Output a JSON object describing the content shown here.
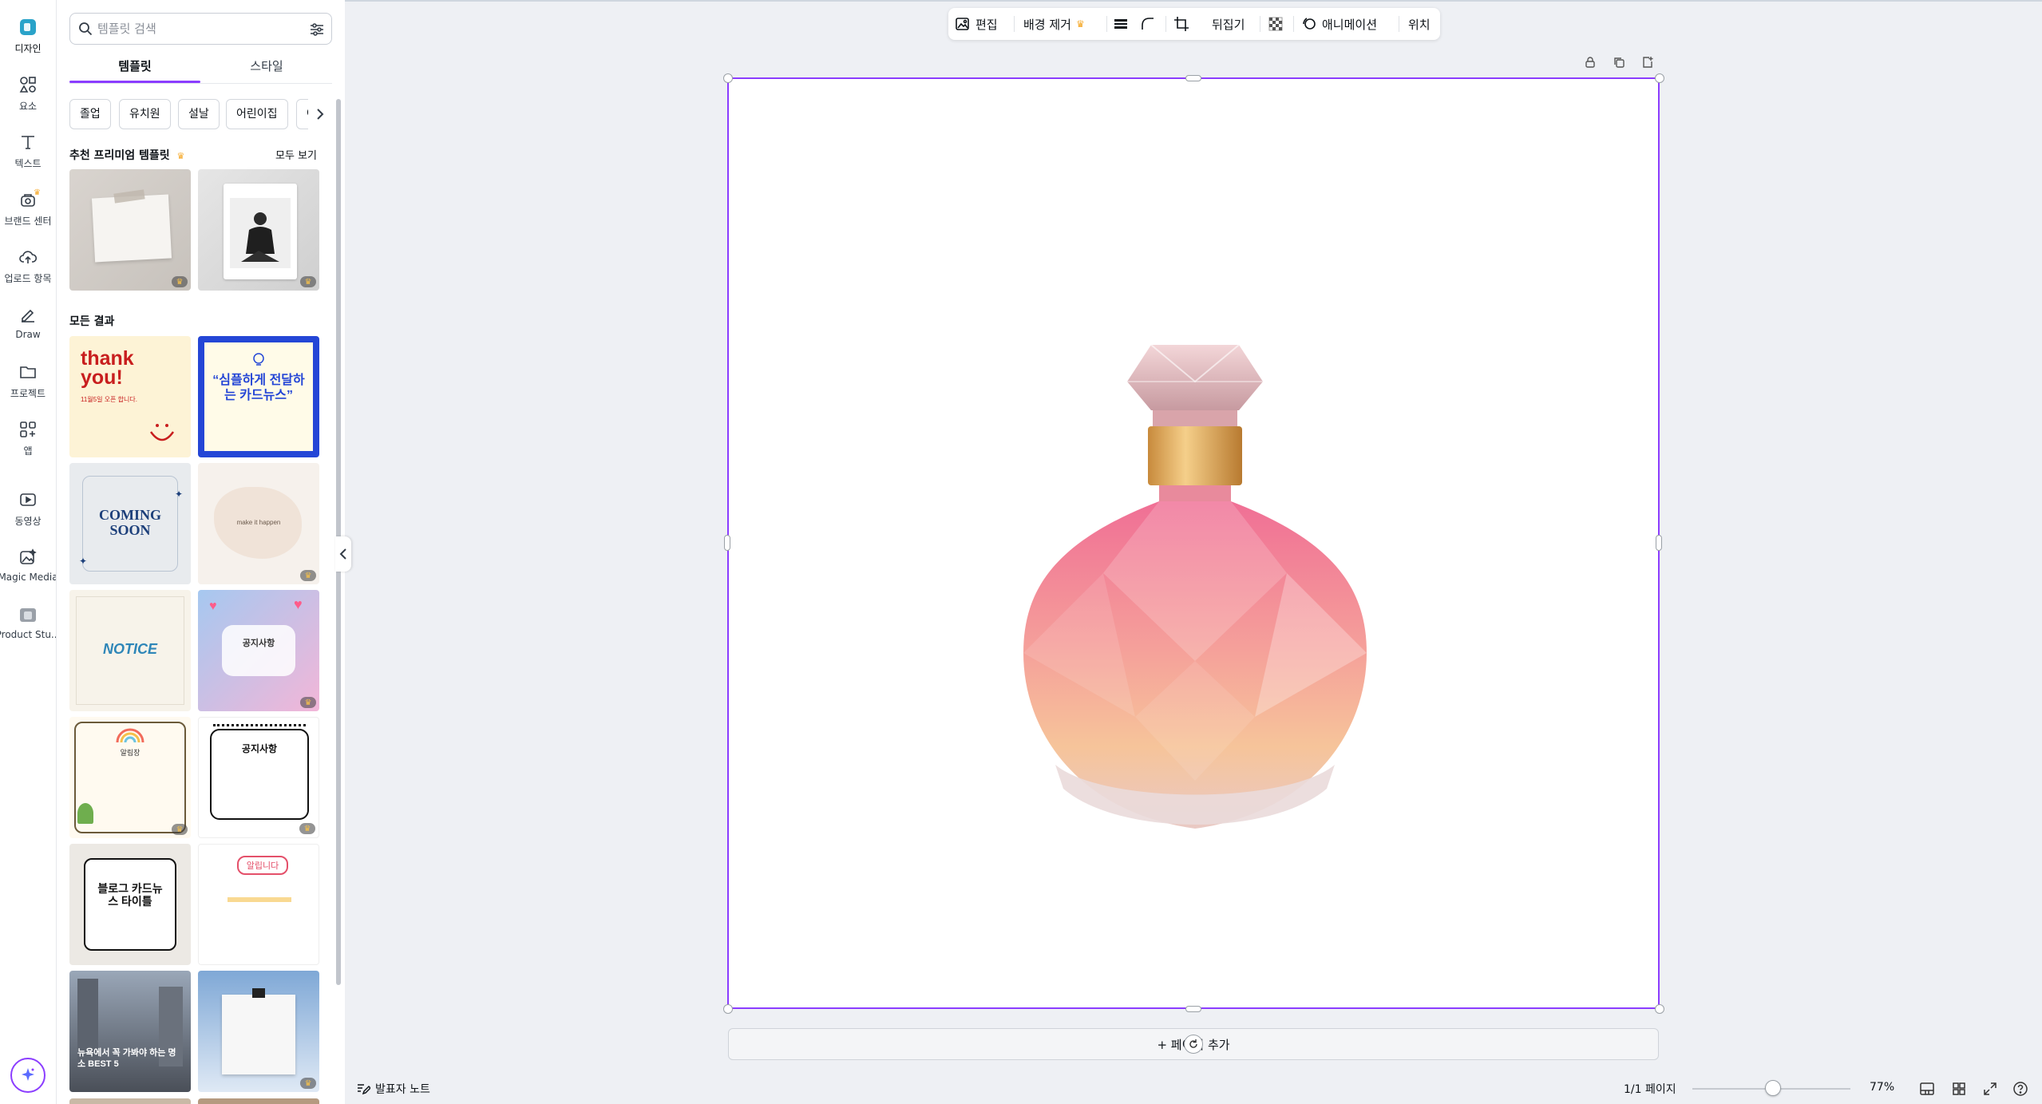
{
  "rail": {
    "items": [
      {
        "label": "디자인",
        "icon": "design-icon"
      },
      {
        "label": "요소",
        "icon": "elements-icon"
      },
      {
        "label": "텍스트",
        "icon": "text-icon"
      },
      {
        "label": "브랜드 센터",
        "icon": "brand-icon"
      },
      {
        "label": "업로드 항목",
        "icon": "upload-cloud-icon"
      },
      {
        "label": "Draw",
        "icon": "draw-pen-icon"
      },
      {
        "label": "프로젝트",
        "icon": "folder-icon"
      },
      {
        "label": "앱",
        "icon": "apps-icon"
      },
      {
        "label": "동영상",
        "icon": "video-icon"
      },
      {
        "label": "Magic Media",
        "icon": "magic-media-icon"
      },
      {
        "label": "Product Stu...",
        "icon": "product-studio-icon"
      }
    ]
  },
  "panel": {
    "search_placeholder": "템플릿 검색",
    "tabs": [
      "템플릿",
      "스타일"
    ],
    "chips": [
      "졸업",
      "유치원",
      "설날",
      "어린이집",
      "여"
    ],
    "premium_heading": "추천 프리미엄 템플릿",
    "see_all": "모두 보기",
    "all_results_heading": "모든 결과",
    "templates": {
      "t1": {
        "line1": "thank",
        "line2": "you!",
        "sub": "11월5일 오픈 합니다."
      },
      "t2": {
        "text": "“심플하게 전달하는 카드뉴스”"
      },
      "t3": {
        "line1": "COMING",
        "line2": "SOON"
      },
      "t4": {
        "text": "make it happen"
      },
      "t5": {
        "text": "NOTICE"
      },
      "t6": {
        "text": "공지사항"
      },
      "t7": {
        "text": "알림장"
      },
      "t8": {
        "text": "공지사항"
      },
      "t9": {
        "text": "블로그 카드뉴스 타이틀"
      },
      "t10": {
        "text": "알립니다"
      },
      "t11": {
        "text": "뉴욕에서 꼭 가봐야 하는 명소 BEST 5"
      }
    }
  },
  "toolbar": {
    "edit": "편집",
    "bg_remove": "배경 제거",
    "flip": "뒤집기",
    "animate": "애니메이션",
    "position": "위치"
  },
  "canvas": {
    "add_page": "+ 페이지 추가"
  },
  "bottom": {
    "notes": "발표자 노트",
    "page_count": "1/1 페이지",
    "zoom": "77%",
    "zoom_level": 0.77
  },
  "colors": {
    "accent": "#8b3dff",
    "crown": "#f5a623"
  }
}
